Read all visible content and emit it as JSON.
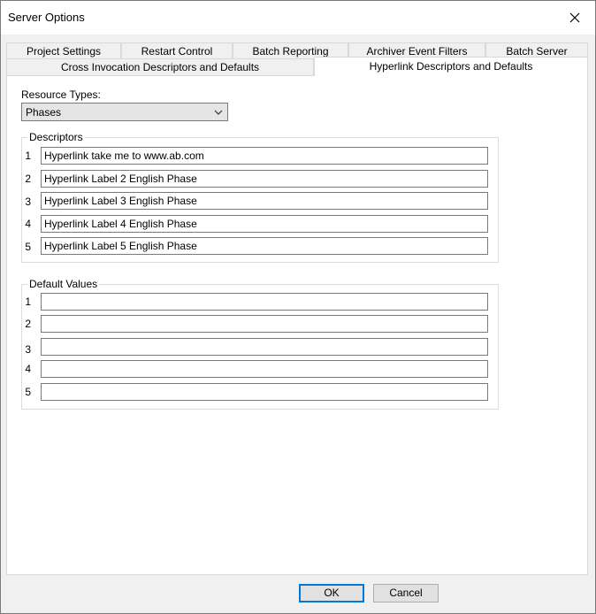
{
  "window": {
    "title": "Server Options"
  },
  "tabs_row1": [
    {
      "label": "Project Settings"
    },
    {
      "label": "Restart Control"
    },
    {
      "label": "Batch Reporting"
    },
    {
      "label": "Archiver Event Filters"
    },
    {
      "label": "Batch Server"
    }
  ],
  "tabs_row2": [
    {
      "label": "Cross Invocation Descriptors and Defaults"
    },
    {
      "label": "Hyperlink Descriptors and Defaults"
    }
  ],
  "resource_types": {
    "label": "Resource Types:",
    "value": "Phases"
  },
  "descriptors": {
    "title": "Descriptors",
    "rows": [
      {
        "num": "1",
        "value": "Hyperlink take me to www.ab.com"
      },
      {
        "num": "2",
        "value": "Hyperlink Label 2 English Phase"
      },
      {
        "num": "3",
        "value": "Hyperlink Label 3 English Phase"
      },
      {
        "num": "4",
        "value": "Hyperlink Label 4 English Phase"
      },
      {
        "num": "5",
        "value": "Hyperlink Label 5 English Phase"
      }
    ]
  },
  "defaults": {
    "title": "Default Values",
    "rows": [
      {
        "num": "1",
        "value": ""
      },
      {
        "num": "2",
        "value": ""
      },
      {
        "num": "3",
        "value": ""
      },
      {
        "num": "4",
        "value": ""
      },
      {
        "num": "5",
        "value": ""
      }
    ]
  },
  "buttons": {
    "ok": "OK",
    "cancel": "Cancel"
  },
  "colors": {
    "default_button_border": "#0078d7",
    "background": "#f0f0f0",
    "panel": "#ffffff"
  },
  "icons": {
    "close": "close-icon",
    "dropdown": "chevron-down-icon"
  }
}
